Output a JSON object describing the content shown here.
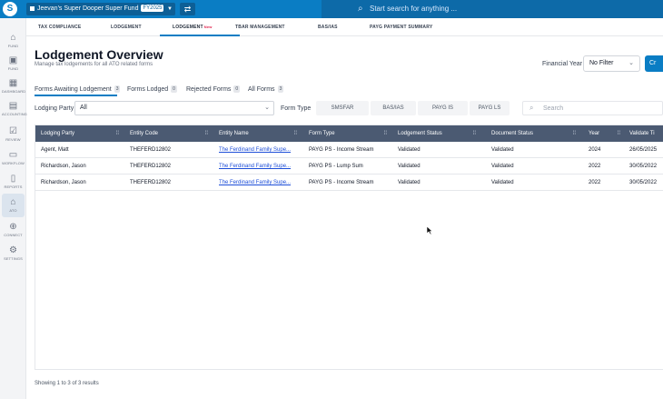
{
  "topbar": {
    "fund_name": "Jeevan's Super Dooper Super Fund",
    "fy_badge": "FY2025",
    "search_placeholder": "Start search for anything ..."
  },
  "sidebar": {
    "items": [
      {
        "label": "FUND",
        "icon": "home-icon"
      },
      {
        "label": "FUND",
        "icon": "fund-icon"
      },
      {
        "label": "DASHBOARD",
        "icon": "dashboard-icon"
      },
      {
        "label": "ACCOUNTING",
        "icon": "accounting-icon"
      },
      {
        "label": "REVIEW",
        "icon": "review-icon"
      },
      {
        "label": "WORKFLOW",
        "icon": "workflow-icon"
      },
      {
        "label": "REPORTS",
        "icon": "reports-icon"
      },
      {
        "label": "ATO",
        "icon": "bank-icon"
      },
      {
        "label": "CONNECT",
        "icon": "connect-icon"
      },
      {
        "label": "SETTINGS",
        "icon": "settings-icon"
      }
    ]
  },
  "navtabs": [
    {
      "label": "TAX COMPLIANCE"
    },
    {
      "label": "LODGEMENT"
    },
    {
      "label": "LODGEMENT",
      "badge": "New"
    },
    {
      "label": "TBAR MANAGEMENT"
    },
    {
      "label": "BAS/IAS"
    },
    {
      "label": "PAYG PAYMENT SUMMARY"
    }
  ],
  "header": {
    "title": "Lodgement Overview",
    "subtitle": "Manage tax lodgements for all ATO related forms",
    "fy_label": "Financial Year",
    "fy_value": "No Filter",
    "action_label": "Cr"
  },
  "filter_tabs": [
    {
      "label": "Forms Awaiting Lodgement",
      "count": "3"
    },
    {
      "label": "Forms Lodged",
      "count": "0"
    },
    {
      "label": "Rejected Forms",
      "count": "0"
    },
    {
      "label": "All Forms",
      "count": "3"
    }
  ],
  "filters": {
    "lodging_party_label": "Lodging Party",
    "lodging_party_value": "All",
    "form_type_label": "Form Type",
    "form_types": [
      "SMSFAR",
      "BAS/IAS",
      "PAYG IS",
      "PAYG LS"
    ],
    "search_placeholder": "Search"
  },
  "table": {
    "columns": [
      "Lodging Party",
      "Entity Code",
      "Entity Name",
      "Form Type",
      "Lodgement Status",
      "Document Status",
      "Year",
      "Validate Ti"
    ],
    "rows": [
      [
        "Agent, Matt",
        "THEFERD12802",
        "The Ferdinand Family Supe...",
        "PAYG PS - Income Stream",
        "Validated",
        "Validated",
        "2024",
        "26/05/2025"
      ],
      [
        "Richardson, Jason",
        "THEFERD12802",
        "The Ferdinand Family Supe...",
        "PAYG PS - Lump Sum",
        "Validated",
        "Validated",
        "2022",
        "30/05/2022"
      ],
      [
        "Richardson, Jason",
        "THEFERD12802",
        "The Ferdinand Family Supe...",
        "PAYG PS - Income Stream",
        "Validated",
        "Validated",
        "2022",
        "30/05/2022"
      ]
    ]
  },
  "footer": {
    "text": "Showing 1 to 3 of 3 results"
  },
  "colors": {
    "brand": "#0a7dc4",
    "table_header": "#4b5a72",
    "link": "#1d4ed8"
  }
}
